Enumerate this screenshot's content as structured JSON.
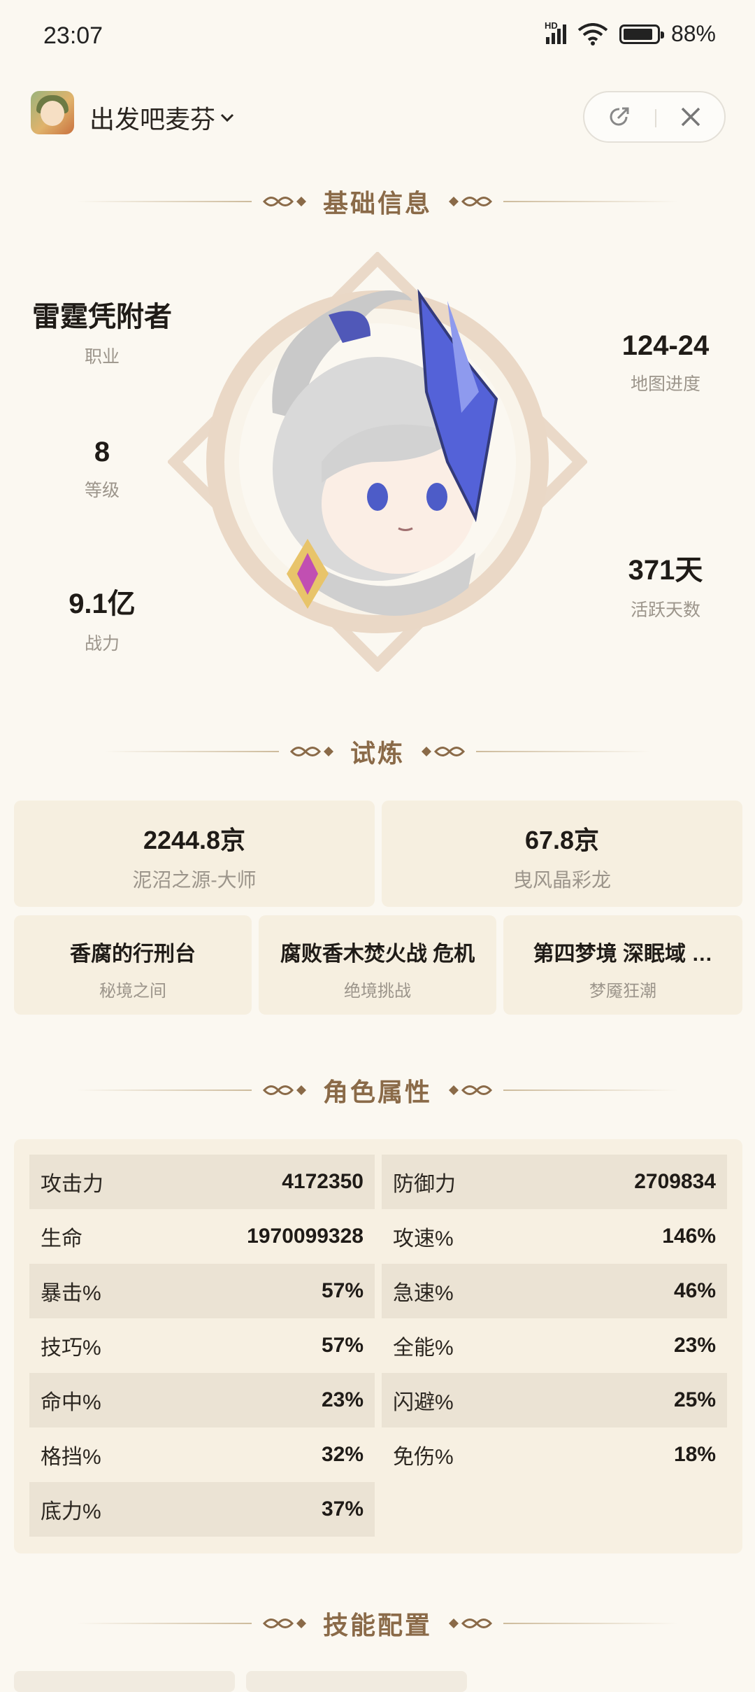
{
  "status_bar": {
    "time": "23:07",
    "network": "HD",
    "battery": "88%"
  },
  "header": {
    "app_name": "出发吧麦芬"
  },
  "sections": {
    "basic": "基础信息",
    "trial": "试炼",
    "attributes": "角色属性",
    "skills": "技能配置"
  },
  "basic_info": {
    "class_value": "雷霆凭附者",
    "class_label": "职业",
    "level_value": "8",
    "level_label": "等级",
    "power_value": "9.1亿",
    "power_label": "战力",
    "map_value": "124-24",
    "map_label": "地图进度",
    "days_value": "371天",
    "days_label": "活跃天数"
  },
  "trials": {
    "big": [
      {
        "value": "2244.8京",
        "sub": "泥沼之源-大师"
      },
      {
        "value": "67.8京",
        "sub": "曳风晶彩龙"
      }
    ],
    "small": [
      {
        "title": "香腐的行刑台",
        "sub": "秘境之间"
      },
      {
        "title": "腐败香木焚火战 危机",
        "sub": "绝境挑战"
      },
      {
        "title": "第四梦境 深眠域 …",
        "sub": "梦魇狂潮"
      }
    ]
  },
  "attributes": {
    "rows": [
      {
        "name": "攻击力",
        "value": "4172350"
      },
      {
        "name": "防御力",
        "value": "2709834"
      },
      {
        "name": "生命",
        "value": "1970099328"
      },
      {
        "name": "攻速%",
        "value": "146%"
      },
      {
        "name": "暴击%",
        "value": "57%"
      },
      {
        "name": "急速%",
        "value": "46%"
      },
      {
        "name": "技巧%",
        "value": "57%"
      },
      {
        "name": "全能%",
        "value": "23%"
      },
      {
        "name": "命中%",
        "value": "23%"
      },
      {
        "name": "闪避%",
        "value": "25%"
      },
      {
        "name": "格挡%",
        "value": "32%"
      },
      {
        "name": "免伤%",
        "value": "18%"
      },
      {
        "name": "底力%",
        "value": "37%"
      }
    ]
  }
}
